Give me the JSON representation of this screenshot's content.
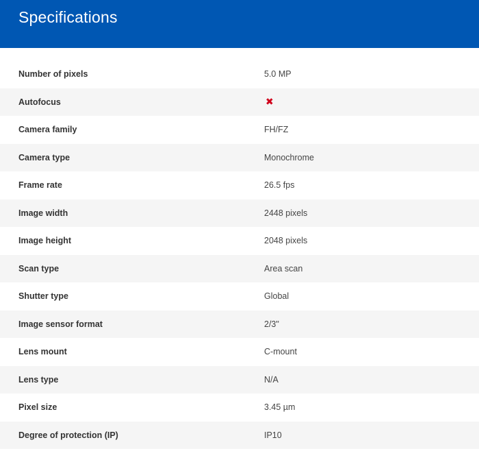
{
  "header": {
    "title": "Specifications",
    "bg_color": "#0057b3"
  },
  "specs": [
    {
      "label": "Number of pixels",
      "value": "5.0 MP"
    },
    {
      "label": "Autofocus",
      "value": null,
      "icon": "cross-icon",
      "icon_color": "#d0021b"
    },
    {
      "label": "Camera family",
      "value": "FH/FZ"
    },
    {
      "label": "Camera type",
      "value": "Monochrome"
    },
    {
      "label": "Frame rate",
      "value": "26.5 fps"
    },
    {
      "label": "Image width",
      "value": "2448 pixels"
    },
    {
      "label": "Image height",
      "value": "2048 pixels"
    },
    {
      "label": "Scan type",
      "value": "Area scan"
    },
    {
      "label": "Shutter type",
      "value": "Global"
    },
    {
      "label": "Image sensor format",
      "value": "2/3\""
    },
    {
      "label": "Lens mount",
      "value": "C-mount"
    },
    {
      "label": "Lens type",
      "value": "N/A"
    },
    {
      "label": "Pixel size",
      "value": "3.45 µm"
    },
    {
      "label": "Degree of protection (IP)",
      "value": "IP10"
    }
  ]
}
